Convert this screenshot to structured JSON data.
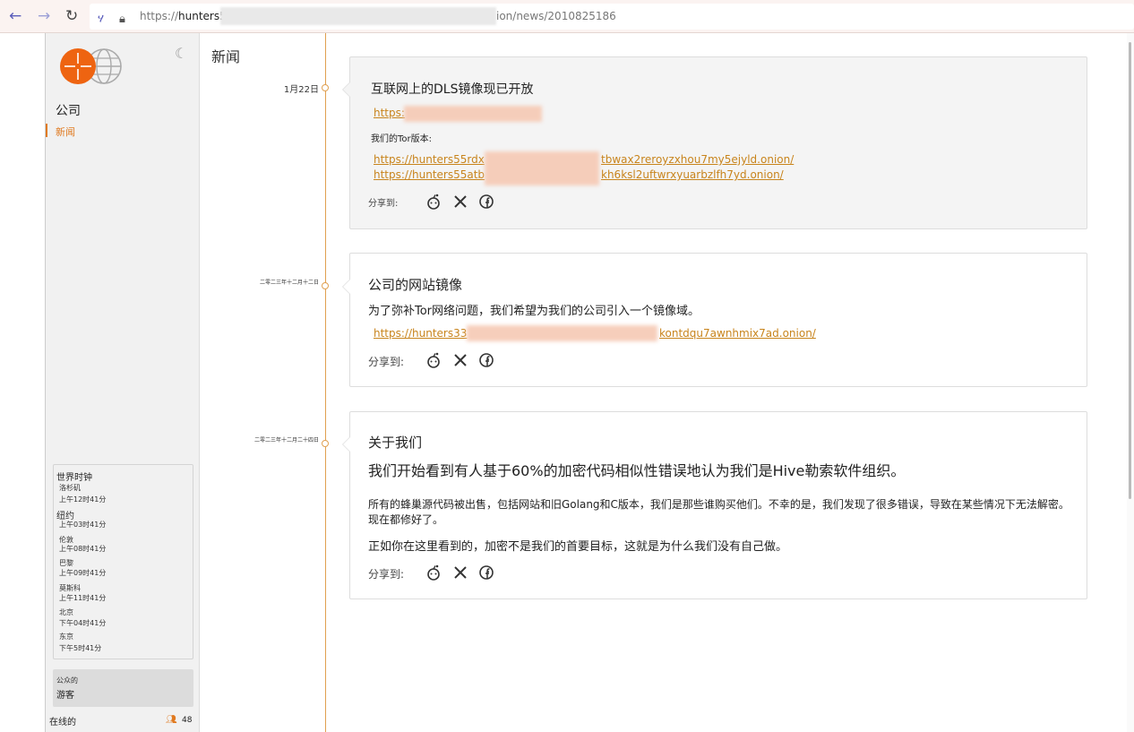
{
  "browser": {
    "back_icon": "arrow-left-icon",
    "forward_icon": "arrow-right-icon",
    "reload_icon": "reload-icon",
    "url_prefix": "https://",
    "url_host": "hunters55",
    "url_suffix": "ion/news/2010825186"
  },
  "sidebar": {
    "company_label": "公司",
    "news_label": "新闻",
    "world_clock": {
      "title": "世界时钟",
      "cities": [
        {
          "city": "洛杉矶",
          "time": "上午12时41分"
        },
        {
          "city": "纽约",
          "time": "上午03时41分"
        },
        {
          "city": "伦敦",
          "time": "上午08时41分"
        },
        {
          "city": "巴黎",
          "time": "上午09时41分"
        },
        {
          "city": "莫斯科",
          "time": "上午11时41分"
        },
        {
          "city": "北京",
          "time": "下午04时41分"
        },
        {
          "city": "东京",
          "time": "下午5时41分"
        }
      ]
    },
    "visitor": {
      "public_label": "公众的",
      "guest_label": "游客"
    },
    "online": {
      "label": "在线的",
      "count": "48"
    }
  },
  "main": {
    "title": "新闻",
    "posts": [
      {
        "date": "1月22日",
        "title": "互联网上的DLS镜像现已开放",
        "link_prefix": "https:",
        "tor_label": "我们的Tor版本:",
        "tor_link_1_prefix": "https://hunters55rdx",
        "tor_link_1_suffix": "tbwax2reroyzxhou7my5ejyld.onion/",
        "tor_link_2_prefix": "https://hunters55atb",
        "tor_link_2_suffix": "kh6ksl2uftwrxyuarbzlfh7yd.onion/",
        "share_label": "分享到:"
      },
      {
        "date": "二零二三年十二月十二日",
        "title": "公司的网站镜像",
        "text": "为了弥补Tor网络问题，我们希望为我们的公司引入一个镜像域。",
        "link_prefix": "https://hunters33",
        "link_suffix": "kontdqu7awnhmix7ad.onion/",
        "share_label": "分享到:"
      },
      {
        "date": "二零二三年十二月二十四日",
        "title": "关于我们",
        "headline": "我们开始看到有人基于60%的加密代码相似性错误地认为我们是Hive勒索软件组织。",
        "para_1": "所有的蜂巢源代码被出售，包括网站和旧Golang和C版本，我们是那些谁购买他们。不幸的是，我们发现了很多错误，导致在某些情况下无法解密。现在都修好了。",
        "para_2": "正如你在这里看到的，加密不是我们的首要目标，这就是为什么我们没有自己做。",
        "share_label": "分享到:"
      }
    ],
    "share_icons": [
      "reddit-icon",
      "x-icon",
      "facebook-icon"
    ]
  },
  "colors": {
    "accent": "#e07a20",
    "link": "#c8841c",
    "timeline": "#e0a050"
  }
}
